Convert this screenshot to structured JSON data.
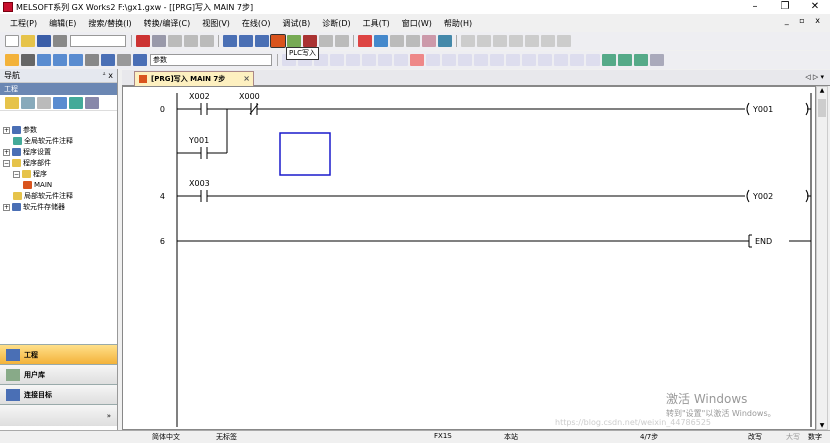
{
  "window": {
    "title": "MELSOFT系列 GX Works2 F:\\gx1.gxw - [[PRG]写入 MAIN 7步]",
    "min": "–",
    "restore": "❐",
    "close": "✕",
    "right_controls": "_ ▫ x"
  },
  "menu": [
    "工程(P)",
    "编辑(E)",
    "搜索/替换(I)",
    "转换/编译(C)",
    "视图(V)",
    "在线(O)",
    "调试(B)",
    "诊断(D)",
    "工具(T)",
    "窗口(W)",
    "帮助(H)"
  ],
  "toolbar": {
    "param_select": "参数",
    "tooltip": "PLC写入"
  },
  "nav": {
    "title": "导航",
    "pin": "ᗮ x",
    "section": "工程",
    "tree": [
      {
        "label": "参数",
        "level": 0,
        "exp": "+"
      },
      {
        "label": "全局软元件注释",
        "level": 1,
        "exp": ""
      },
      {
        "label": "程序设置",
        "level": 0,
        "exp": "+"
      },
      {
        "label": "程序部件",
        "level": 0,
        "exp": "−"
      },
      {
        "label": "程序",
        "level": 1,
        "exp": "−"
      },
      {
        "label": "MAIN",
        "level": 2,
        "exp": ""
      },
      {
        "label": "局部软元件注释",
        "level": 1,
        "exp": ""
      },
      {
        "label": "软元件存储器",
        "level": 0,
        "exp": "+"
      }
    ],
    "bottom": [
      {
        "label": "工程",
        "active": true
      },
      {
        "label": "用户库",
        "active": false
      },
      {
        "label": "连接目标",
        "active": false
      }
    ],
    "more": "»"
  },
  "tab": {
    "label": "[PRG]写入 MAIN 7步",
    "close": "×",
    "nav": "◁ ▷ ▾"
  },
  "ladder": {
    "rungs": [
      {
        "step": "0",
        "contacts": [
          "X002",
          "X000"
        ],
        "parallel": "Y001",
        "coil": "Y001"
      },
      {
        "step": "4",
        "contacts": [
          "X003"
        ],
        "coil": "Y002"
      },
      {
        "step": "6",
        "coil": "END"
      }
    ]
  },
  "status": {
    "lang": "简体中文",
    "label": "无标签",
    "plc": "FX1S",
    "station": "本站",
    "steps": "4/7步",
    "mode": "改写",
    "caps": "大写",
    "num": "数字"
  },
  "watermark": {
    "line1": "激活 Windows",
    "line2": "转到\"设置\"以激活 Windows。",
    "url": "https://blog.csdn.net/weixin_44786525"
  }
}
